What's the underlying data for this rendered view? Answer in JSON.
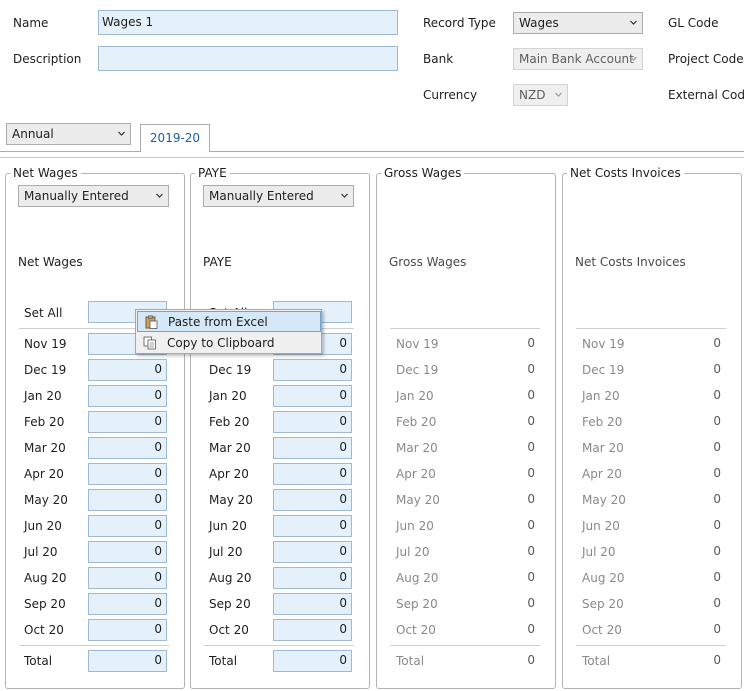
{
  "header": {
    "name_label": "Name",
    "name_value": "Wages 1",
    "description_label": "Description",
    "description_value": "",
    "record_type_label": "Record Type",
    "record_type_value": "Wages",
    "bank_label": "Bank",
    "bank_value": "Main Bank Account",
    "currency_label": "Currency",
    "currency_value": "NZD",
    "gl_code_label": "GL Code",
    "project_code_label": "Project Code",
    "external_code_label": "External Code"
  },
  "period_select": "Annual",
  "tabs": [
    {
      "label": "2019-20"
    }
  ],
  "set_all_label": "Set All",
  "total_label": "Total",
  "months": [
    "Nov 19",
    "Dec 19",
    "Jan 20",
    "Feb 20",
    "Mar 20",
    "Apr 20",
    "May 20",
    "Jun 20",
    "Jul 20",
    "Aug 20",
    "Sep 20",
    "Oct 20"
  ],
  "groups": [
    {
      "title": "Net Wages",
      "mode": "Manually Entered",
      "heading": "Net Wages",
      "values": [
        "",
        "0",
        "0",
        "0",
        "0",
        "0",
        "0",
        "0",
        "0",
        "0",
        "0",
        "0"
      ],
      "total": "0",
      "editable": true
    },
    {
      "title": "PAYE",
      "mode": "Manually Entered",
      "heading": "PAYE",
      "values": [
        "0",
        "0",
        "0",
        "0",
        "0",
        "0",
        "0",
        "0",
        "0",
        "0",
        "0",
        "0"
      ],
      "total": "0",
      "editable": true
    },
    {
      "title": "Gross Wages",
      "heading": "Gross Wages",
      "values": [
        "0",
        "0",
        "0",
        "0",
        "0",
        "0",
        "0",
        "0",
        "0",
        "0",
        "0",
        "0"
      ],
      "total": "0",
      "editable": false
    },
    {
      "title": "Net Costs Invoices",
      "heading": "Net Costs Invoices",
      "values": [
        "0",
        "0",
        "0",
        "0",
        "0",
        "0",
        "0",
        "0",
        "0",
        "0",
        "0",
        "0"
      ],
      "total": "0",
      "editable": false
    }
  ],
  "context_menu": {
    "items": [
      {
        "label": "Paste from Excel",
        "icon": "paste-icon"
      },
      {
        "label": "Copy to Clipboard",
        "icon": "copy-icon"
      }
    ]
  }
}
